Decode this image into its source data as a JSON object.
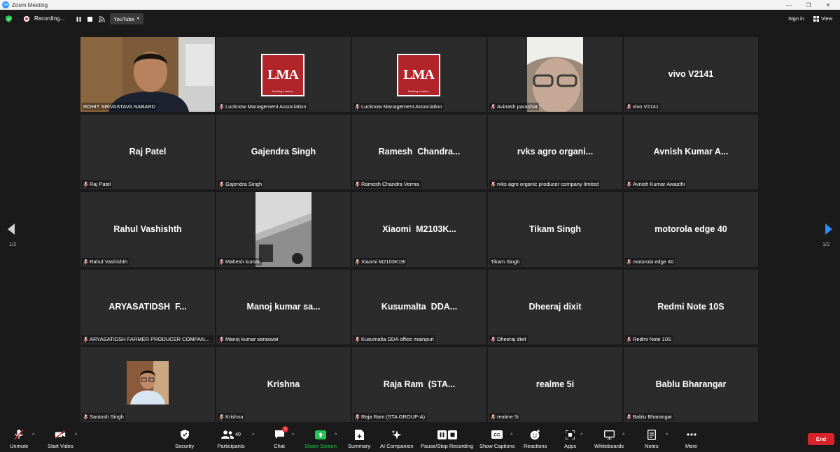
{
  "window": {
    "title": "Zoom Meeting"
  },
  "topbar": {
    "recording_label": "Recording...",
    "stream_target": "YouTube",
    "signin": "Sign in",
    "view": "View"
  },
  "colors": {
    "accent": "#2d8cff",
    "active_speaker": "#d8e23c",
    "end": "#d8232a",
    "tile_bg": "#2b2b2b"
  },
  "pagination": {
    "left": "1/2",
    "right": "1/2"
  },
  "tiles": [
    {
      "name": "ROHIT SRIVASTAVA NABARD",
      "display": "",
      "type": "video-man",
      "muted": false,
      "active": true
    },
    {
      "name": "Lucknow Management Association",
      "display": "",
      "type": "logo",
      "muted": true
    },
    {
      "name": "Lucknow Management Association",
      "display": "",
      "type": "logo",
      "muted": true
    },
    {
      "name": "Avinash parashar",
      "display": "",
      "type": "video-woman",
      "muted": true
    },
    {
      "name": "vivo V2141",
      "display": "vivo V2141",
      "type": "text",
      "muted": true
    },
    {
      "name": "Raj Patel",
      "display": "Raj Patel",
      "type": "text",
      "muted": true
    },
    {
      "name": "Gajendra Singh",
      "display": "Gajendra Singh",
      "type": "text",
      "muted": true
    },
    {
      "name": "Ramesh Chandra Verma",
      "display": "Ramesh  Chandra...",
      "type": "text",
      "muted": true
    },
    {
      "name": "rvks agro organic producer company limited",
      "display": "rvks agro organi...",
      "type": "text",
      "muted": true
    },
    {
      "name": "Avnish Kumar Awasthi",
      "display": "Avnish Kumar A...",
      "type": "text",
      "muted": true
    },
    {
      "name": "Rahul Vashishth",
      "display": "Rahul Vashishth",
      "type": "text",
      "muted": true
    },
    {
      "name": "Mahesh kumar",
      "display": "",
      "type": "video-ceiling",
      "muted": true
    },
    {
      "name": "Xiaomi M2103K19I",
      "display": "Xiaomi  M2103K...",
      "type": "text",
      "muted": true
    },
    {
      "name": "Tikam Singh",
      "display": "Tikam Singh",
      "type": "text",
      "muted": false
    },
    {
      "name": "motorola edge 40",
      "display": "motorola edge 40",
      "type": "text",
      "muted": true
    },
    {
      "name": "ARYASATIDSH FARMER PRODUCER COMPANY ...",
      "display": "ARYASATIDSH  F...",
      "type": "text",
      "muted": true
    },
    {
      "name": "Manoj kumar saraswat",
      "display": "Manoj kumar sa...",
      "type": "text",
      "muted": true
    },
    {
      "name": "Kusumalta DDA office mainpuri",
      "display": "Kusumalta  DDA...",
      "type": "text",
      "muted": true
    },
    {
      "name": "Dheeraj dixit",
      "display": "Dheeraj dixit",
      "type": "text",
      "muted": true
    },
    {
      "name": "Redmi Note 10S",
      "display": "Redmi Note 10S",
      "type": "text",
      "muted": true
    },
    {
      "name": "Santosh Singh",
      "display": "",
      "type": "photo",
      "muted": true
    },
    {
      "name": "Krishna",
      "display": "Krishna",
      "type": "text",
      "muted": true
    },
    {
      "name": "Raja Ram  (STA GROUP-A)",
      "display": "Raja Ram  (STA...",
      "type": "text",
      "muted": true
    },
    {
      "name": "realme 5i",
      "display": "realme 5i",
      "type": "text",
      "muted": true
    },
    {
      "name": "Bablu Bharangar",
      "display": "Bablu Bharangar",
      "type": "text",
      "muted": true
    }
  ],
  "logo": {
    "text": "LMA",
    "tagline": "Building Leaders"
  },
  "toolbar": {
    "unmute": "Unmute",
    "start_video": "Start Video",
    "security": "Security",
    "participants": "Participants",
    "participants_count": "40",
    "chat": "Chat",
    "chat_badge": "3",
    "share_screen": "Share Screen",
    "summary": "Summary",
    "ai_companion": "AI Companion",
    "pause_stop_recording": "Pause/Stop Recording",
    "show_captions": "Show Captions",
    "reactions": "Reactions",
    "apps": "Apps",
    "whiteboards": "Whiteboards",
    "notes": "Notes",
    "more": "More",
    "end": "End"
  }
}
